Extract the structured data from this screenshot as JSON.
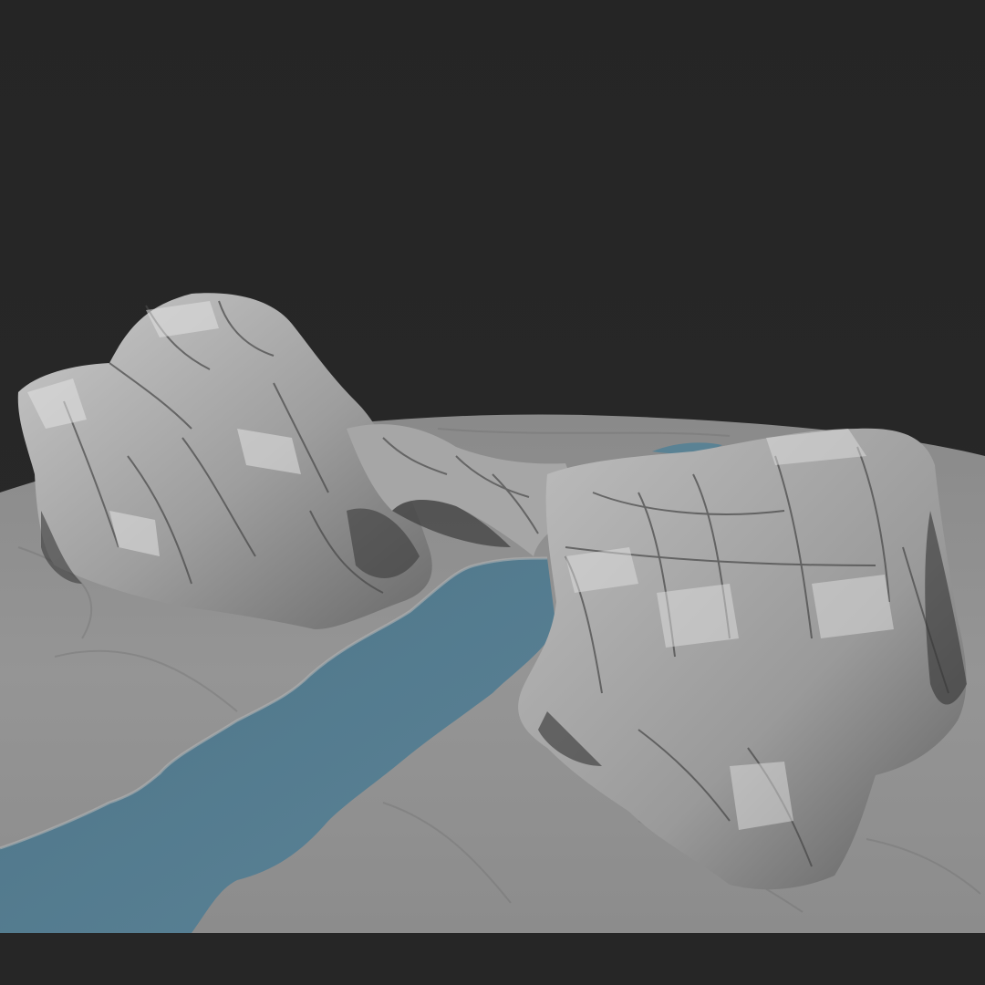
{
  "viewport": {
    "background_color": "#262626",
    "ground_color": "#8f8f8f",
    "water_color": "#577f93",
    "rock_light": "#cfcfcf",
    "rock_mid": "#a2a2a2",
    "rock_dark": "#5a5a5a"
  }
}
